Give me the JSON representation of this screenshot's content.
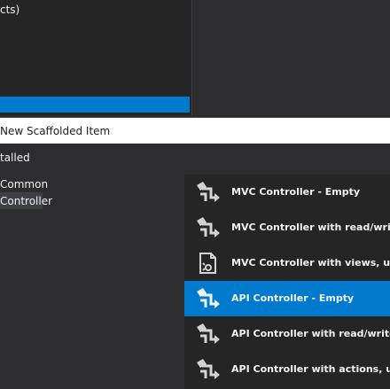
{
  "background_menu": {
    "partial_text": "cts)"
  },
  "dialog": {
    "title": "New Scaffolded Item",
    "tree": {
      "installed_label": "talled",
      "common_label": "Common",
      "controller_label": "Controller"
    },
    "templates": [
      {
        "label": "MVC Controller - Empty",
        "icon": "controller-icon",
        "selected": false
      },
      {
        "label": "MVC Controller with read/write",
        "icon": "controller-icon",
        "selected": false
      },
      {
        "label": "MVC Controller with views, using",
        "icon": "document-gear-icon",
        "selected": false
      },
      {
        "label": "API Controller - Empty",
        "icon": "controller-icon",
        "selected": true
      },
      {
        "label": "API Controller with read/write a",
        "icon": "controller-icon",
        "selected": false
      },
      {
        "label": "API Controller with actions, using",
        "icon": "controller-icon",
        "selected": false
      }
    ]
  },
  "colors": {
    "accent": "#007acc",
    "background": "#2d2d30",
    "panel": "#252526",
    "text": "#f1f1f1"
  }
}
